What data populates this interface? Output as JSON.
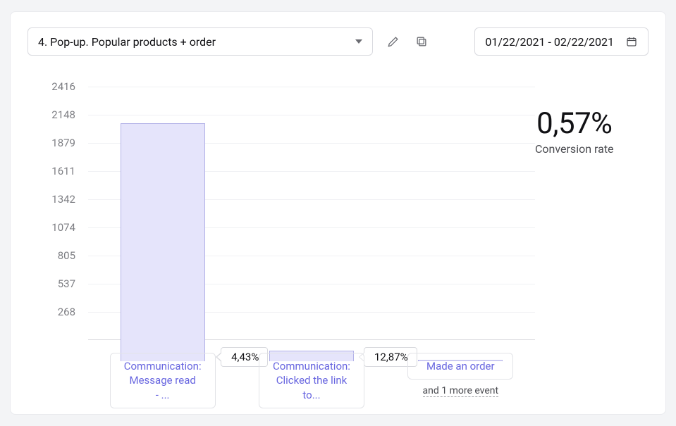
{
  "toolbar": {
    "funnel_selected": "4. Pop-up. Popular products + order",
    "date_range": "01/22/2021 - 02/22/2021",
    "icons": {
      "edit": "pencil-icon",
      "copy": "copy-icon",
      "calendar": "calendar-icon",
      "dropdown": "chevron-down-icon"
    }
  },
  "kpi": {
    "value": "0,57%",
    "label": "Conversion rate"
  },
  "steps": [
    {
      "label_line1": "Communication:",
      "label_line2": "Message read",
      "label_line3": "- ..."
    },
    {
      "label_line1": "Communication:",
      "label_line2": "Clicked the link",
      "label_line3": "to...",
      "pct_from_prev": "4,43%"
    },
    {
      "label_line1": "Made an order",
      "pct_from_prev": "12,87%",
      "more_events_text": "and 1 more event"
    }
  ],
  "chart_data": {
    "type": "bar",
    "categories": [
      "Communication: Message read - ...",
      "Communication: Clicked the link to...",
      "Made an order"
    ],
    "values": [
      2270,
      101,
      13
    ],
    "step_conversion": [
      null,
      "4,43%",
      "12,87%"
    ],
    "ylim": [
      0,
      2416
    ],
    "y_ticks": [
      268,
      537,
      805,
      1074,
      1342,
      1611,
      1879,
      2148,
      2416
    ],
    "title": "",
    "xlabel": "",
    "ylabel": "",
    "overall_conversion": "0,57%"
  },
  "colors": {
    "bar_fill": "#e5e4fb",
    "bar_border": "#b3b2e8",
    "link": "#6866e0"
  }
}
